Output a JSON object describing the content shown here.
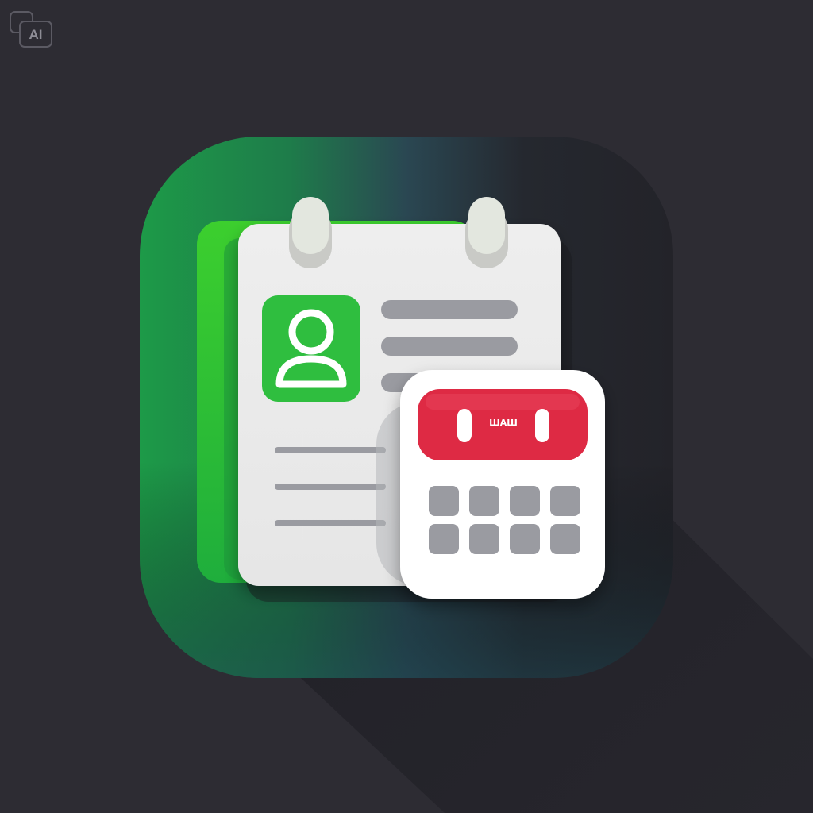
{
  "badge": {
    "text": "AI"
  },
  "calendar": {
    "header_text": "ШАШ"
  },
  "icons": {
    "app_icon": "contact-calendar-app-icon",
    "document": "document-icon",
    "avatar": "user-avatar-icon",
    "calendar": "calendar-icon"
  },
  "colors": {
    "background": "#2d2c33",
    "tile_green": "#1fa04a",
    "tile_dark": "#25262d",
    "accent_green": "#2fbe3f",
    "calendar_red": "#de2a44",
    "paper": "#ececec",
    "line_gray": "#9a9ba1"
  }
}
